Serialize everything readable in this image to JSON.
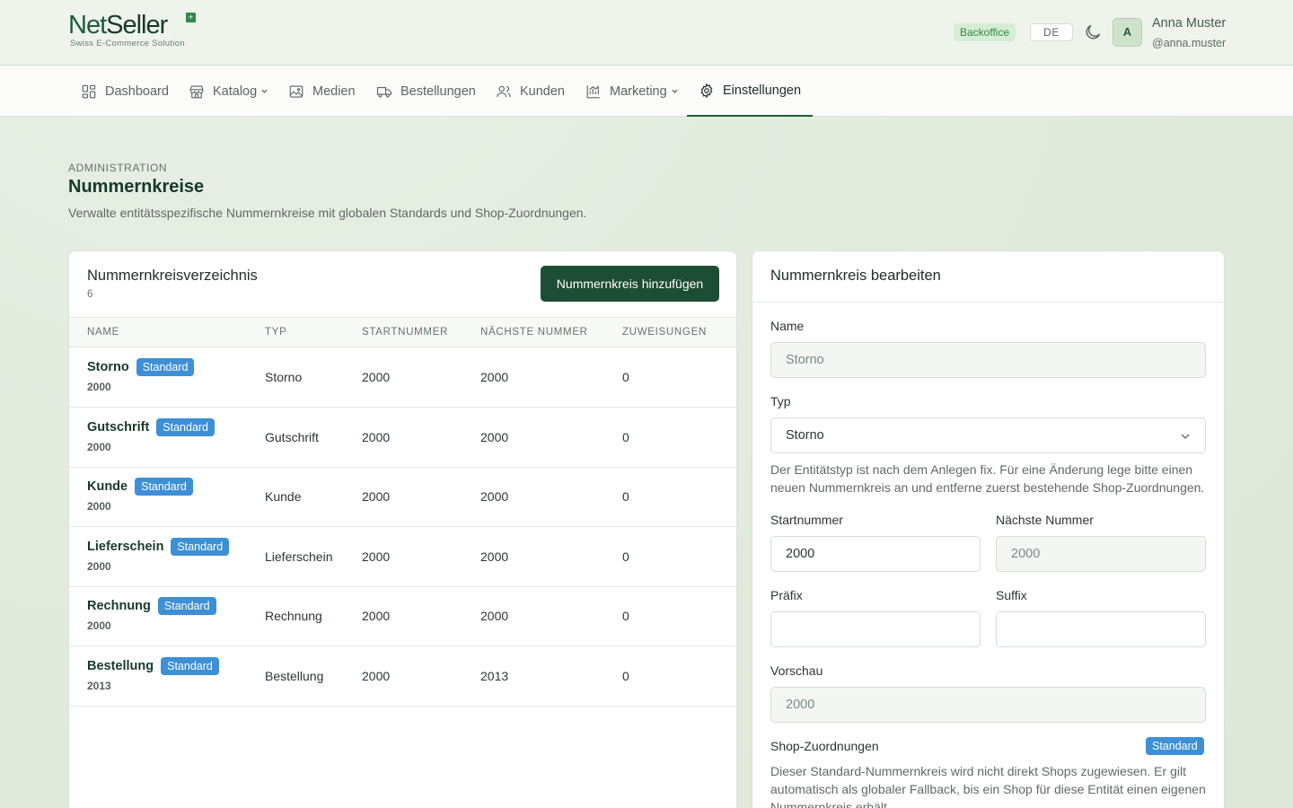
{
  "brand": {
    "name_part1": "Net",
    "name_part2": "Seller",
    "tagline": "Swiss E-Commerce Solution",
    "mark": "+"
  },
  "header": {
    "backoffice_label": "Backoffice",
    "language": "DE",
    "user": {
      "initial": "A",
      "name": "Anna Muster",
      "handle": "@anna.muster"
    }
  },
  "nav": {
    "items": [
      {
        "label": "Dashboard",
        "icon": "dashboard-icon"
      },
      {
        "label": "Katalog",
        "icon": "store-icon",
        "dropdown": true
      },
      {
        "label": "Medien",
        "icon": "image-icon"
      },
      {
        "label": "Bestellungen",
        "icon": "truck-icon"
      },
      {
        "label": "Kunden",
        "icon": "users-icon"
      },
      {
        "label": "Marketing",
        "icon": "chart-icon",
        "dropdown": true
      },
      {
        "label": "Einstellungen",
        "icon": "gear-icon",
        "active": true
      }
    ]
  },
  "page": {
    "eyebrow": "ADMINISTRATION",
    "title": "Nummernkreise",
    "description": "Verwalte entitätsspezifische Nummernkreise mit globalen Standards und Shop-Zuordnungen."
  },
  "list": {
    "title": "Nummernkreisverzeichnis",
    "count": "6",
    "add_button": "Nummernkreis hinzufügen",
    "columns": [
      "NAME",
      "TYP",
      "STARTNUMMER",
      "NÄCHSTE NUMMER",
      "ZUWEISUNGEN"
    ],
    "rows": [
      {
        "name": "Storno",
        "badge": "Standard",
        "sub": "2000",
        "type": "Storno",
        "start": "2000",
        "next": "2000",
        "assignments": "0"
      },
      {
        "name": "Gutschrift",
        "badge": "Standard",
        "sub": "2000",
        "type": "Gutschrift",
        "start": "2000",
        "next": "2000",
        "assignments": "0"
      },
      {
        "name": "Kunde",
        "badge": "Standard",
        "sub": "2000",
        "type": "Kunde",
        "start": "2000",
        "next": "2000",
        "assignments": "0"
      },
      {
        "name": "Lieferschein",
        "badge": "Standard",
        "sub": "2000",
        "type": "Lieferschein",
        "start": "2000",
        "next": "2000",
        "assignments": "0"
      },
      {
        "name": "Rechnung",
        "badge": "Standard",
        "sub": "2000",
        "type": "Rechnung",
        "start": "2000",
        "next": "2000",
        "assignments": "0"
      },
      {
        "name": "Bestellung",
        "badge": "Standard",
        "sub": "2013",
        "type": "Bestellung",
        "start": "2000",
        "next": "2013",
        "assignments": "0"
      }
    ]
  },
  "form": {
    "title": "Nummernkreis bearbeiten",
    "name_label": "Name",
    "name_value": "Storno",
    "type_label": "Typ",
    "type_value": "Storno",
    "type_help": "Der Entitätstyp ist nach dem Anlegen fix. Für eine Änderung lege bitte einen neuen Nummernkreis an und entferne zuerst bestehende Shop-Zuordnungen.",
    "start_label": "Startnummer",
    "start_value": "2000",
    "next_label": "Nächste Nummer",
    "next_value": "2000",
    "prefix_label": "Präfix",
    "prefix_value": "",
    "suffix_label": "Suffix",
    "suffix_value": "",
    "preview_label": "Vorschau",
    "preview_value": "2000",
    "shop_label": "Shop-Zuordnungen",
    "shop_badge": "Standard",
    "shop_help": "Dieser Standard-Nummernkreis wird nicht direkt Shops zugewiesen. Er gilt automatisch als globaler Fallback, bis ein Shop für diese Entität einen eigenen Nummernkreis erhält."
  },
  "colors": {
    "brand_green": "#1d5c3a",
    "primary_button": "#1d4d34",
    "badge_blue": "#3d8fd6",
    "backoffice_green": "#2a8a43"
  }
}
